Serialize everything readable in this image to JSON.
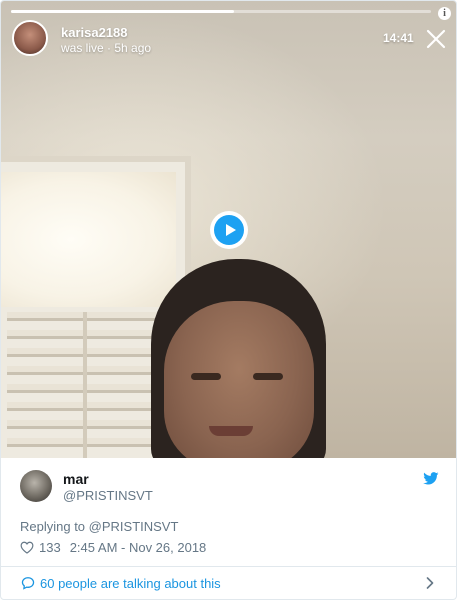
{
  "live": {
    "username": "karisa2188",
    "status": "was live · 5h ago",
    "clock": "14:41",
    "progress_fraction": 0.53
  },
  "tweet": {
    "author_name": "mar",
    "author_handle": "@PRISTINSVT",
    "replying_prefix": "Replying to ",
    "replying_handle": "@PRISTINSVT",
    "like_count": "133",
    "timestamp": "2:45 AM - Nov 26, 2018",
    "talking_text": "60 people are talking about this"
  },
  "icons": {
    "info": "info-icon",
    "close": "close-icon",
    "play": "play-icon",
    "bird": "twitter-bird-icon",
    "heart": "heart-icon",
    "bubble": "speech-bubble-icon",
    "chevron": "chevron-right-icon"
  },
  "colors": {
    "accent": "#1da1f2",
    "link": "#1b95e0",
    "muted": "#657786"
  }
}
